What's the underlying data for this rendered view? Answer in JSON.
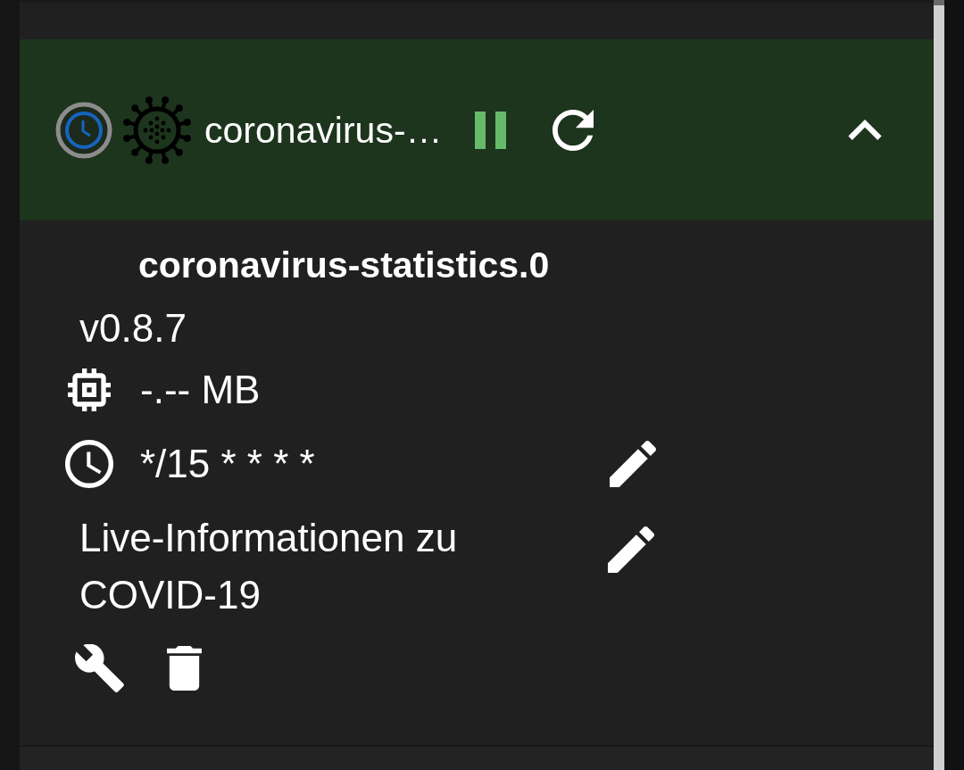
{
  "adapter": {
    "kind": "scheduled",
    "title": "coronavirus-…",
    "running": true,
    "expanded": true
  },
  "details": {
    "name": "coronavirus-statistics.0",
    "version": "v0.8.7",
    "memory": "-.-- MB",
    "schedule": "*/15 * * * *",
    "description": "Live-Informationen zu COVID-19"
  }
}
